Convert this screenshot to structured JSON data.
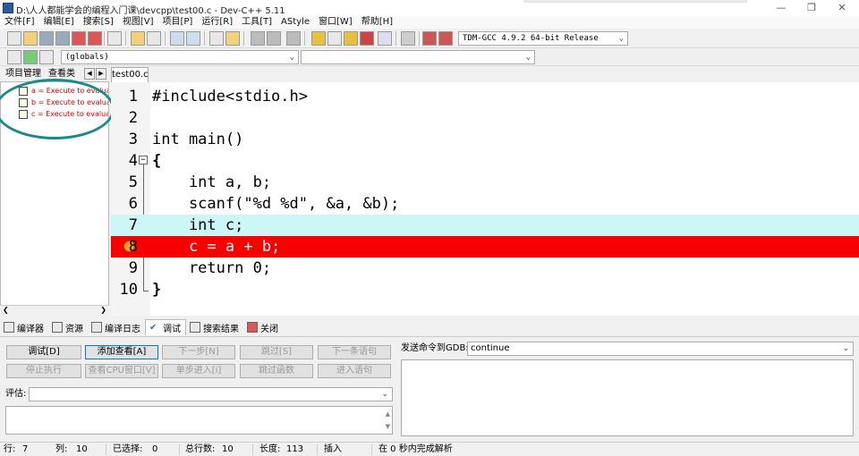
{
  "window": {
    "title": "D:\\人人都能学会的编程入门课\\devcpp\\test00.c - Dev-C++ 5.11"
  },
  "menu": [
    "文件[F]",
    "编辑[E]",
    "搜索[S]",
    "视图[V]",
    "项目[P]",
    "运行[R]",
    "工具[T]",
    "AStyle",
    "窗口[W]",
    "帮助[H]"
  ],
  "toolbar": {
    "compiler": "TDM-GCC 4.9.2 64-bit Release",
    "scope": "(globals)",
    "function": ""
  },
  "left_pane": {
    "tabs": [
      "项目管理",
      "查看类"
    ],
    "watches": [
      "a = Execute to evaluate",
      "b = Execute to evaluate",
      "c = Execute to evaluate"
    ]
  },
  "editor": {
    "tab": "test00.c",
    "lines": [
      {
        "n": "1",
        "text": "#include<stdio.h>"
      },
      {
        "n": "2",
        "text": ""
      },
      {
        "n": "3",
        "text": "int main()"
      },
      {
        "n": "4",
        "text": "{"
      },
      {
        "n": "5",
        "text": "    int a, b;"
      },
      {
        "n": "6",
        "text": "    scanf(\"%d %d\", &a, &b);"
      },
      {
        "n": "7",
        "text": "    int c;"
      },
      {
        "n": "8",
        "text": "    c = a + b;"
      },
      {
        "n": "9",
        "text": "    return 0;"
      },
      {
        "n": "10",
        "text": "}"
      }
    ]
  },
  "bottom_tabs": [
    "编译器",
    "资源",
    "编译日志",
    "调试",
    "搜索结果",
    "关闭"
  ],
  "debug": {
    "buttons_row1": [
      "调试[D]",
      "添加查看[A]",
      "下一步[N]",
      "跳过[S]",
      "下一条语句"
    ],
    "buttons_row2": [
      "停止执行",
      "查看CPU窗口[V]",
      "单步进入[i]",
      "跳过函数",
      "进入语句"
    ],
    "eval_label": "评估:",
    "eval_value": "",
    "gdb_label": "发送命令到GDB:",
    "gdb_value": "continue"
  },
  "status": {
    "row_label": "行:",
    "row": "7",
    "col_label": "列:",
    "col": "10",
    "sel_label": "已选择:",
    "sel": "0",
    "lines_label": "总行数:",
    "lines": "10",
    "len_label": "长度:",
    "len": "113",
    "mode": "插入",
    "parse": "在 0 秒内完成解析"
  }
}
